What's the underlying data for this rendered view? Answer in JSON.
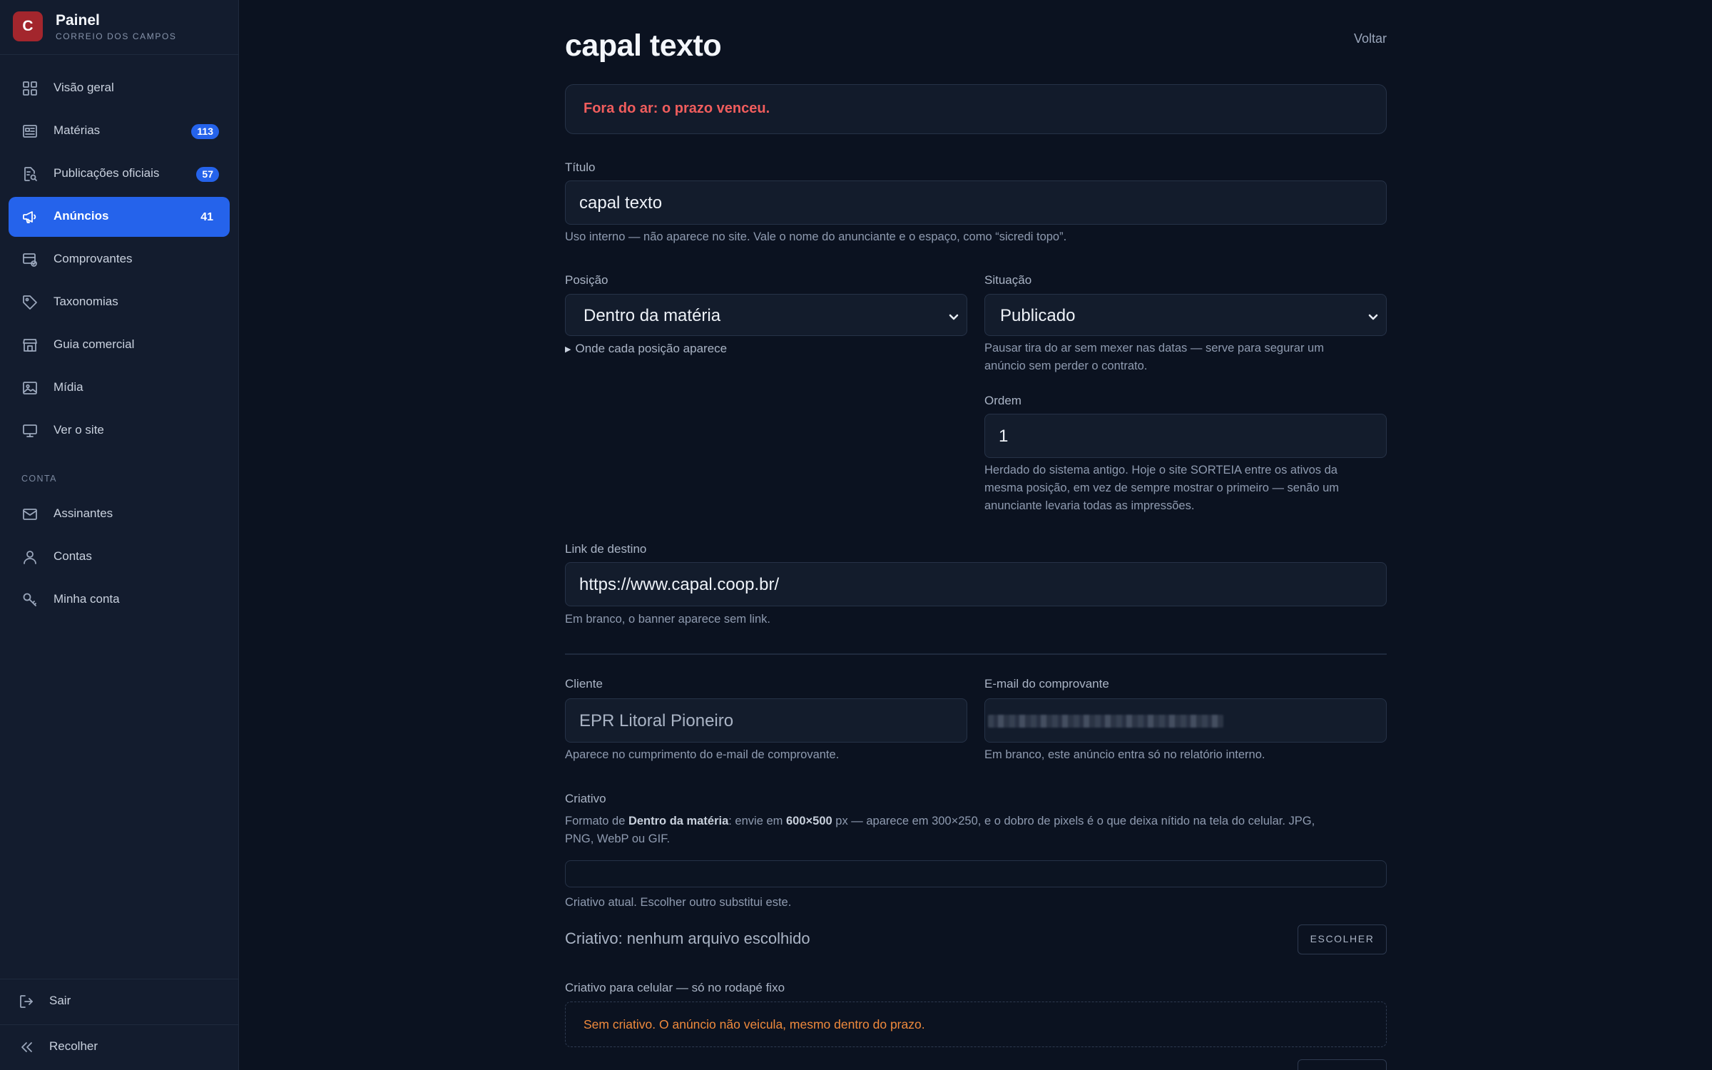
{
  "brand": {
    "logo_letter": "C",
    "title": "Painel",
    "subtitle": "CORREIO DOS CAMPOS"
  },
  "sidebar": {
    "items": [
      {
        "label": "Visão geral",
        "icon": "grid-icon"
      },
      {
        "label": "Matérias",
        "icon": "newspaper-icon",
        "badge": "113"
      },
      {
        "label": "Publicações oficiais",
        "icon": "document-search-icon",
        "badge": "57"
      },
      {
        "label": "Anúncios",
        "icon": "megaphone-icon",
        "badge": "41",
        "active": true
      },
      {
        "label": "Comprovantes",
        "icon": "receipt-icon"
      },
      {
        "label": "Taxonomias",
        "icon": "tag-icon"
      },
      {
        "label": "Guia comercial",
        "icon": "store-icon"
      },
      {
        "label": "Mídia",
        "icon": "image-icon"
      },
      {
        "label": "Ver o site",
        "icon": "monitor-icon"
      }
    ],
    "section_label": "CONTA",
    "account_items": [
      {
        "label": "Assinantes",
        "icon": "mail-icon"
      },
      {
        "label": "Contas",
        "icon": "user-icon"
      },
      {
        "label": "Minha conta",
        "icon": "key-icon"
      }
    ],
    "footer": {
      "logout": "Sair",
      "collapse": "Recolher"
    }
  },
  "page": {
    "title": "capal texto",
    "back": "Voltar",
    "alert": "Fora do ar: o prazo venceu."
  },
  "form": {
    "titulo": {
      "label": "Título",
      "value": "capal texto",
      "hint": "Uso interno — não aparece no site. Vale o nome do anunciante e o espaço, como “sicredi topo”."
    },
    "posicao": {
      "label": "Posição",
      "value": "Dentro da matéria",
      "details": "Onde cada posição aparece"
    },
    "situacao": {
      "label": "Situação",
      "value": "Publicado",
      "hint_1": "Pausar tira do ar sem mexer nas datas — serve para segurar um",
      "hint_2": "anúncio sem perder o contrato."
    },
    "ordem": {
      "label": "Ordem",
      "value": "1",
      "hint_1": "Herdado do sistema antigo. Hoje o site SORTEIA entre os ativos da",
      "hint_2": "mesma posição, em vez de sempre mostrar o primeiro — senão um",
      "hint_3": "anunciante levaria todas as impressões."
    },
    "link": {
      "label": "Link de destino",
      "value": "https://www.capal.coop.br/",
      "hint": "Em branco, o banner aparece sem link."
    },
    "cliente": {
      "label": "Cliente",
      "value": "EPR Litoral Pioneiro",
      "hint": "Aparece no cumprimento do e-mail de comprovante."
    },
    "email": {
      "label": "E-mail do comprovante",
      "hint": "Em branco, este anúncio entra só no relatório interno."
    },
    "criativo": {
      "label": "Criativo",
      "hint_pre": "Formato de ",
      "hint_format": "Dentro da matéria",
      "hint_mid": ": envie em ",
      "hint_size": "600×500",
      "hint_post": " px — aparece em 300×250, e o dobro de pixels é o que deixa nítido na tela do celular. JPG,",
      "hint_line2": "PNG, WebP ou GIF.",
      "current_hint": "Criativo atual. Escolher outro substitui este.",
      "file_status": "Criativo: nenhum arquivo escolhido",
      "choose": "ESCOLHER"
    },
    "criativo_celular": {
      "label": "Criativo para celular — só no rodapé fixo",
      "warning": "Sem criativo. O anúncio não veicula, mesmo dentro do prazo."
    }
  },
  "colors": {
    "accent": "#2563eb",
    "danger": "#f05d5d",
    "warning": "#f08a3c",
    "brand": "#a3262d",
    "background": "#0b1220",
    "sidebar": "#131c2e"
  }
}
